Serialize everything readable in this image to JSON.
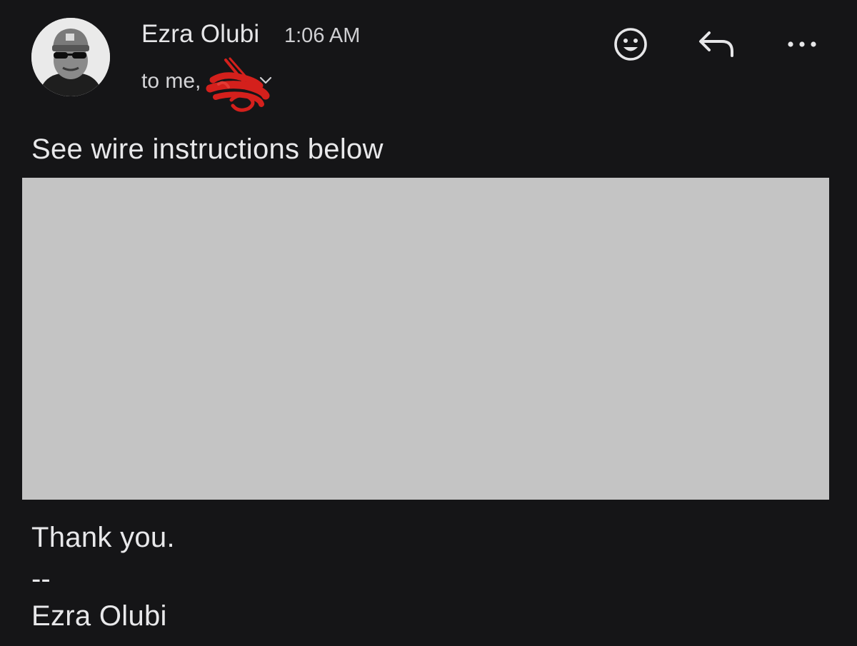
{
  "message": {
    "sender": {
      "name": "Ezra Olubi",
      "avatar_icon": "person-avatar"
    },
    "time": "1:06 AM",
    "recipients_text": "to me,",
    "actions": {
      "emoji_icon": "smiley-face-icon",
      "reply_icon": "reply-arrow-icon",
      "more_icon": "more-horizontal-icon"
    },
    "body": {
      "intro": "See wire instructions below",
      "closing": "Thank you.",
      "separator": "--",
      "signature_name": "Ezra Olubi"
    }
  },
  "colors": {
    "background": "#151517",
    "text": "#e8e8ea",
    "redaction_block": "#c4c4c4",
    "scribble": "#d4201c",
    "link": "#8ab4f8"
  }
}
